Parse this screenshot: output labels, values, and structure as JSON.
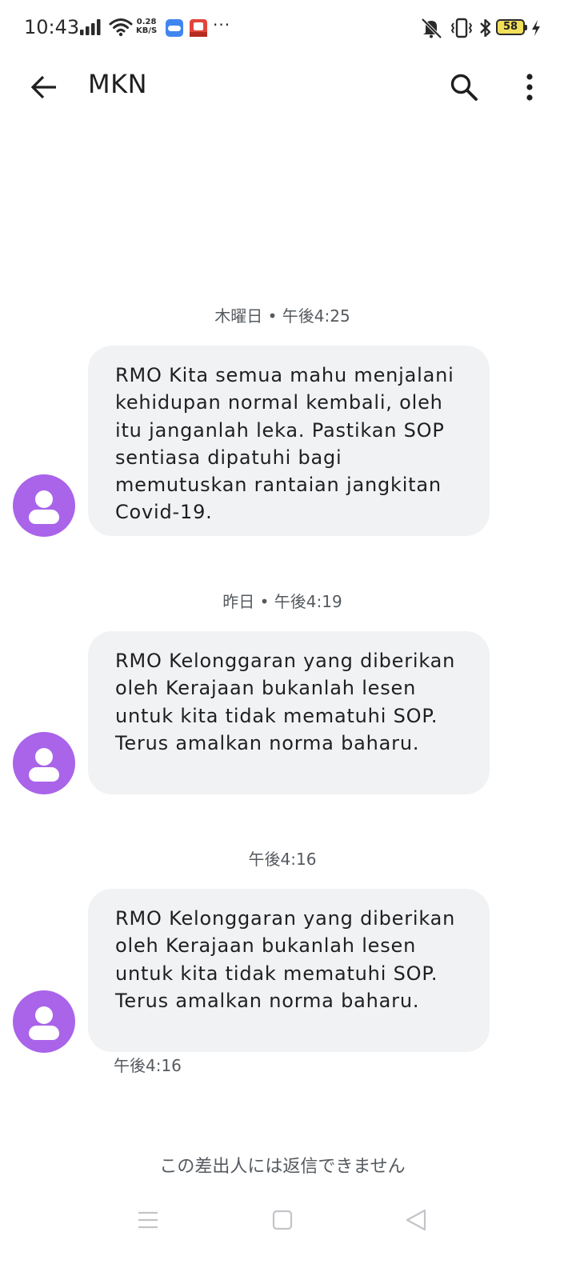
{
  "status_bar": {
    "time": "10:43",
    "speed_value": "0.28",
    "speed_unit": "KB/S",
    "more": "···",
    "battery": "58",
    "icons": [
      "signal-icon",
      "wifi-icon",
      "app-icon",
      "shopping-app-icon",
      "mute-icon",
      "vibrate-icon",
      "bluetooth-icon",
      "battery-icon",
      "charging-icon"
    ]
  },
  "app_bar": {
    "title": "MKN",
    "icons": [
      "back-arrow-icon",
      "search-icon",
      "more-vert-icon"
    ]
  },
  "conversation": {
    "groups": [
      {
        "timestamp": "木曜日 • 午後4:25",
        "message": "RMO Kita semua mahu menjalani kehidupan normal kembali, oleh itu janganlah leka. Pastikan SOP sentiasa dipatuhi bagi memutuskan rantaian jangkitan Covid-19."
      },
      {
        "timestamp": "昨日 • 午後4:19",
        "message": "RMO Kelonggaran yang diberikan oleh Kerajaan bukanlah lesen untuk kita tidak mematuhi SOP. Terus amalkan norma baharu."
      },
      {
        "timestamp": "午後4:16",
        "message": "RMO Kelonggaran yang diberikan oleh Kerajaan bukanlah lesen untuk kita tidak mematuhi SOP. Terus amalkan norma baharu."
      }
    ],
    "last_message_time": "午後4:16"
  },
  "footer": {
    "cannot_reply": "この差出人には返信できません"
  },
  "nav_bar": {
    "icons": [
      "recent-apps-icon",
      "home-icon",
      "back-icon"
    ]
  },
  "colors": {
    "avatar": "#a964e9",
    "bubble": "#f1f2f4",
    "battery": "#f2df5a"
  }
}
